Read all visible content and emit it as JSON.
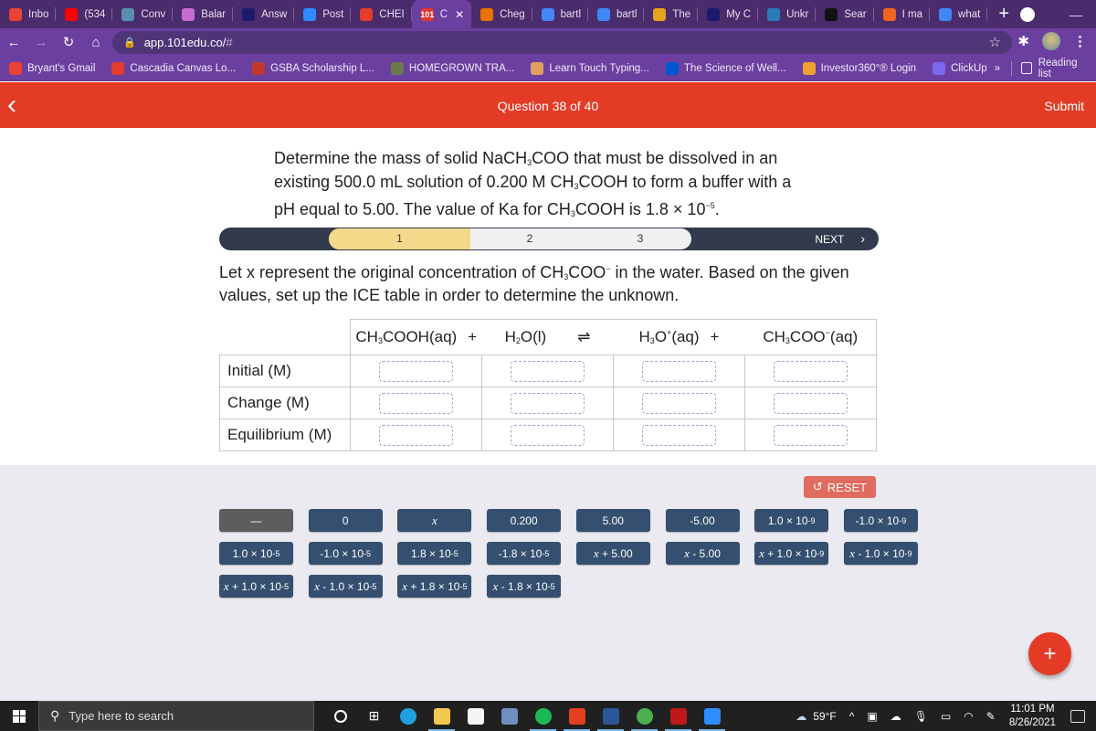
{
  "browser": {
    "tabs": [
      {
        "label": "Inbo",
        "icon": "gmail-icon",
        "color": "#ea4335"
      },
      {
        "label": "(534",
        "icon": "youtube-icon",
        "color": "#ff0000"
      },
      {
        "label": "Conv",
        "icon": "conv-icon",
        "color": "#5a8fb0"
      },
      {
        "label": "Balar",
        "icon": "flask-icon",
        "color": "#c86bd0"
      },
      {
        "label": "Answ",
        "icon": "bartleby-icon",
        "color": "#1a1a6e"
      },
      {
        "label": "Post",
        "icon": "zoom-icon",
        "color": "#2d8cff"
      },
      {
        "label": "CHEI",
        "icon": "canvas-icon",
        "color": "#e13c2c"
      },
      {
        "label": "C",
        "icon": "101edu-icon",
        "color": "#e3342f",
        "active": true
      },
      {
        "label": "Cheg",
        "icon": "chegg-icon",
        "color": "#eb7100"
      },
      {
        "label": "bartl",
        "icon": "google-icon",
        "color": "#4285f4"
      },
      {
        "label": "bartl",
        "icon": "google-icon",
        "color": "#4285f4"
      },
      {
        "label": "The",
        "icon": "the-icon",
        "color": "#e6a21f"
      },
      {
        "label": "My C",
        "icon": "bartleby-icon",
        "color": "#1a1a6e"
      },
      {
        "label": "Unkr",
        "icon": "unkr-icon",
        "color": "#2b7bb9"
      },
      {
        "label": "Sear",
        "icon": "search-site-icon",
        "color": "#111111"
      },
      {
        "label": "I ma",
        "icon": "etsy-icon",
        "color": "#f1641e"
      },
      {
        "label": "what",
        "icon": "google-icon",
        "color": "#4285f4"
      }
    ],
    "active_tab_glyph": "101",
    "new_tab": "+",
    "url": "app.101edu.co/",
    "url_hash": "#",
    "bookmarks": [
      {
        "label": "Bryant's Gmail",
        "icon": "gmail-icon",
        "color": "#ea4335"
      },
      {
        "label": "Cascadia Canvas Lo...",
        "icon": "canvas-icon",
        "color": "#e13c2c"
      },
      {
        "label": "GSBA Scholarship L...",
        "icon": "gsba-icon",
        "color": "#c0392b"
      },
      {
        "label": "HOMEGROWN TRA...",
        "icon": "homegrown-icon",
        "color": "#6b7a4a"
      },
      {
        "label": "Learn Touch Typing...",
        "icon": "typing-icon",
        "color": "#e0a060"
      },
      {
        "label": "The Science of Well...",
        "icon": "coursera-icon",
        "color": "#0056d2"
      },
      {
        "label": "Investor360°® Login",
        "icon": "investor-icon",
        "color": "#f0a030"
      },
      {
        "label": "ClickUp",
        "icon": "clickup-icon",
        "color": "#7b68ee"
      }
    ],
    "bookmarks_more": "»",
    "reading_list": "Reading list"
  },
  "header": {
    "question_counter": "Question 38 of 40",
    "submit_label": "Submit",
    "back_glyph": "‹"
  },
  "question": {
    "line1_a": "Determine the mass of solid NaCH",
    "line1_sub": "3",
    "line1_b": "COO that must be dissolved in an existing 500.0 mL solution of 0.200 M CH",
    "line2_sub": "3",
    "line2_b": "COOH to form a buffer with a pH equal to 5.00. The value of Ka for CH",
    "line3_sub": "3",
    "line3_b": "COOH is 1.8 × 10",
    "line3_sup": "−5",
    "line3_end": "."
  },
  "stepper": {
    "steps": [
      "1",
      "2",
      "3"
    ],
    "current_step": 1,
    "next_label": "NEXT",
    "next_glyph": "›"
  },
  "instruction": {
    "a": "Let x represent the original concentration of CH",
    "sub": "3",
    "b": "COO",
    "sup": "−",
    "c": " in the water. Based on the given values, set up the ICE table in order to determine the unknown."
  },
  "ice_table": {
    "species": [
      {
        "a": "CH",
        "sub": "3",
        "b": "COOH(aq)",
        "sup": "",
        "c": "",
        "op": "+"
      },
      {
        "a": "H",
        "sub": "2",
        "b": "O(l)",
        "sup": "",
        "c": "",
        "op": "⇌"
      },
      {
        "a": "H",
        "sub": "3",
        "b": "O",
        "sup": "+",
        "c": "(aq)",
        "op": "+"
      },
      {
        "a": "CH",
        "sub": "3",
        "b": "COO",
        "sup": "−",
        "c": "(aq)",
        "op": ""
      }
    ],
    "rows": [
      "Initial (M)",
      "Change (M)",
      "Equilibrium (M)"
    ]
  },
  "tray": {
    "reset_label": "RESET",
    "tiles": [
      {
        "pre": "",
        "main": "—",
        "sup": "",
        "gray": true
      },
      {
        "pre": "",
        "main": "0",
        "sup": ""
      },
      {
        "pre": "x",
        "main": "",
        "sup": ""
      },
      {
        "pre": "",
        "main": "0.200",
        "sup": ""
      },
      {
        "pre": "",
        "main": "5.00",
        "sup": ""
      },
      {
        "pre": "",
        "main": "-5.00",
        "sup": ""
      },
      {
        "pre": "",
        "main": "1.0 × 10",
        "sup": "-9"
      },
      {
        "pre": "",
        "main": "-1.0 × 10",
        "sup": "-9"
      },
      {
        "pre": "",
        "main": "1.0 × 10",
        "sup": "-5"
      },
      {
        "pre": "",
        "main": "-1.0 × 10",
        "sup": "-5"
      },
      {
        "pre": "",
        "main": "1.8 × 10",
        "sup": "-5"
      },
      {
        "pre": "",
        "main": "-1.8 × 10",
        "sup": "-5"
      },
      {
        "pre": "x",
        "main": " + 5.00",
        "sup": ""
      },
      {
        "pre": "x",
        "main": " - 5.00",
        "sup": ""
      },
      {
        "pre": "x",
        "main": " + 1.0 × 10",
        "sup": "-9"
      },
      {
        "pre": "x",
        "main": " - 1.0 × 10",
        "sup": "-9"
      },
      {
        "pre": "x",
        "main": " + 1.0 × 10",
        "sup": "-5"
      },
      {
        "pre": "x",
        "main": " - 1.0 × 10",
        "sup": "-5"
      },
      {
        "pre": "x",
        "main": " + 1.8 × 10",
        "sup": "-5"
      },
      {
        "pre": "x",
        "main": " - 1.8 × 10",
        "sup": "-5"
      }
    ],
    "fab_glyph": "+"
  },
  "taskbar": {
    "search_placeholder": "Type here to search",
    "apps": [
      {
        "name": "cortana-icon",
        "color": "#202020"
      },
      {
        "name": "task-view-icon",
        "color": "#202020"
      },
      {
        "name": "edge-icon",
        "color": "#1fa0e0"
      },
      {
        "name": "file-explorer-icon",
        "color": "#f2c94c"
      },
      {
        "name": "store-icon",
        "color": "#f5f5f5"
      },
      {
        "name": "calculator-icon",
        "color": "#6f8fbf"
      },
      {
        "name": "spotify-icon",
        "color": "#1db954"
      },
      {
        "name": "office-icon",
        "color": "#e3401f"
      },
      {
        "name": "word-icon",
        "color": "#2b579a"
      },
      {
        "name": "chrome-icon",
        "color": "#4caf50"
      },
      {
        "name": "mcafee-icon",
        "color": "#c01818"
      },
      {
        "name": "zoom-icon",
        "color": "#2d8cff"
      }
    ],
    "weather": "59°F",
    "time": "11:01 PM",
    "date": "8/26/2021"
  }
}
